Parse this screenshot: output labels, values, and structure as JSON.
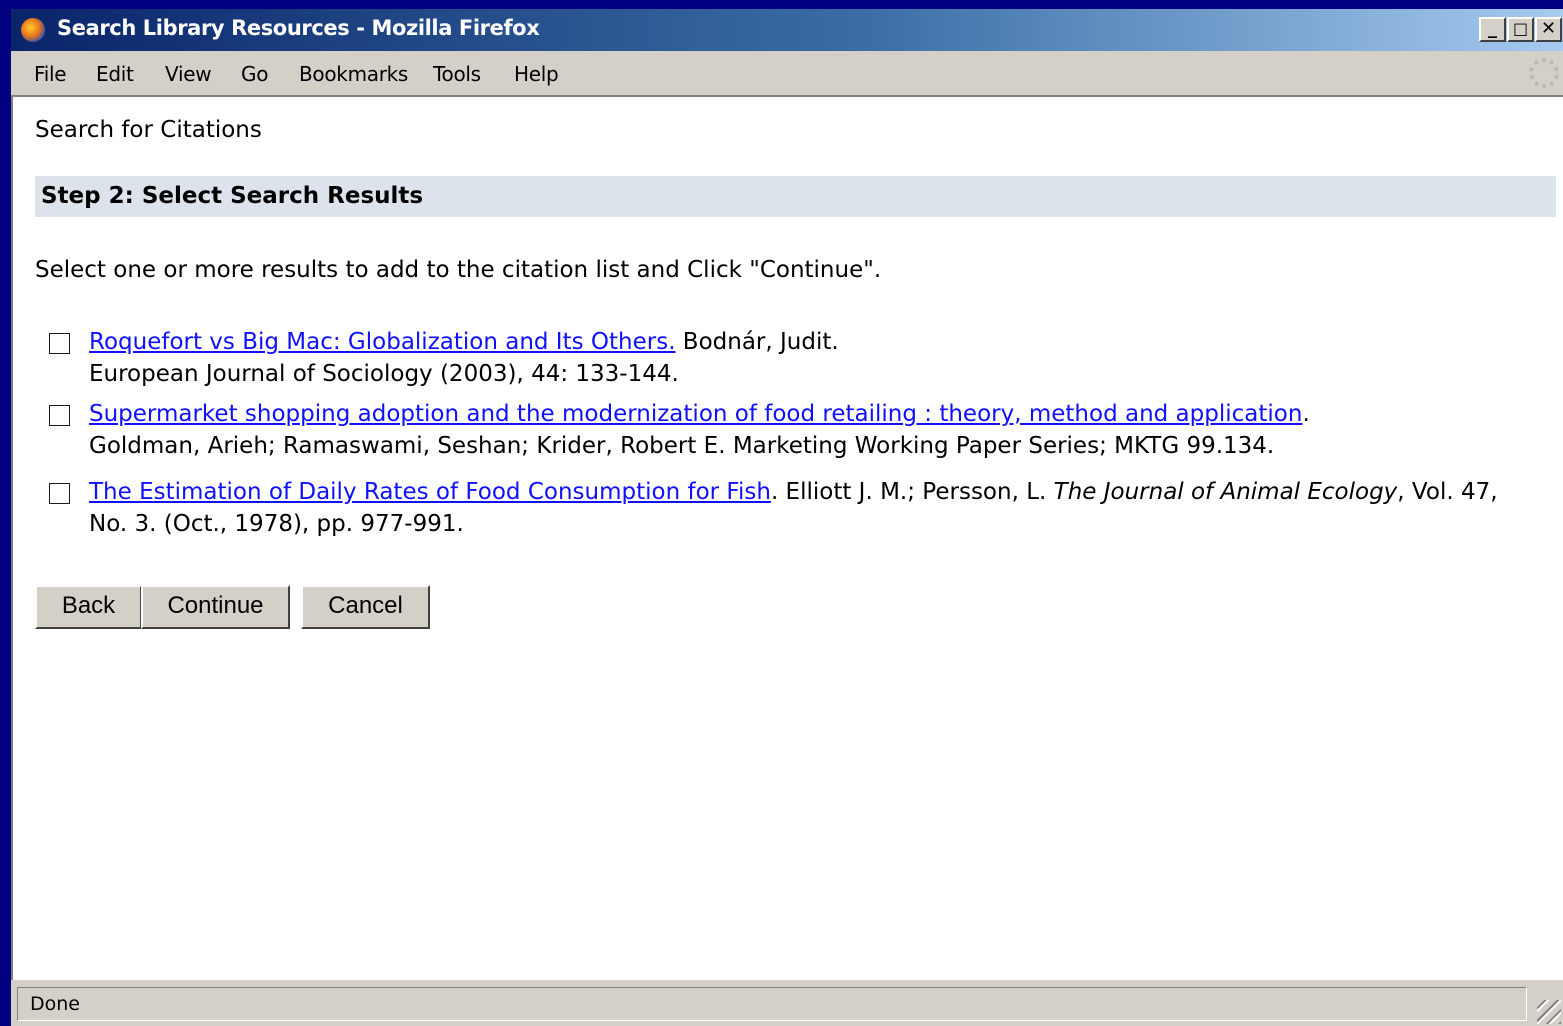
{
  "window": {
    "title": "Search Library Resources - Mozilla Firefox",
    "controls": {
      "minimize": "_",
      "maximize": "□",
      "close": "✕"
    }
  },
  "menu": [
    {
      "label": "File"
    },
    {
      "label": "Edit"
    },
    {
      "label": "View"
    },
    {
      "label": "Go"
    },
    {
      "label": "Bookmarks"
    },
    {
      "label": "Tools"
    },
    {
      "label": "Help"
    }
  ],
  "page": {
    "title": "Search for Citations",
    "step_heading": "Step 2: Select Search Results",
    "instructions": "Select one or more results to add to the citation list and Click \"Continue\"."
  },
  "results": [
    {
      "checked": false,
      "link": "Roquefort vs Big Mac: Globalization and Its Others.",
      "after_link": " Bodnár, Judit.",
      "details": "European Journal of Sociology (2003), 44: 133-144."
    },
    {
      "checked": false,
      "link": "Supermarket shopping adoption and the modernization of food retailing : theory, method and application",
      "after_link": ".",
      "details": "Goldman, Arieh; Ramaswami, Seshan; Krider, Robert E. Marketing Working Paper Series; MKTG 99.134."
    },
    {
      "checked": false,
      "link": "The Estimation of Daily Rates of Food Consumption for Fish",
      "after_link": ". Elliott J. M.; Persson, L. ",
      "journal": "The Journal of Animal Ecology",
      "details": ", Vol. 47, No. 3. (Oct., 1978), pp. 977-991."
    }
  ],
  "buttons": {
    "back": "Back",
    "continue": "Continue",
    "cancel": "Cancel"
  },
  "status": {
    "text": "Done"
  },
  "colors": {
    "link": "#1010ff",
    "step_band": "#dde3eb",
    "titlebar_start": "#0a246a",
    "titlebar_end": "#a6caf0",
    "desktop": "#000080"
  }
}
